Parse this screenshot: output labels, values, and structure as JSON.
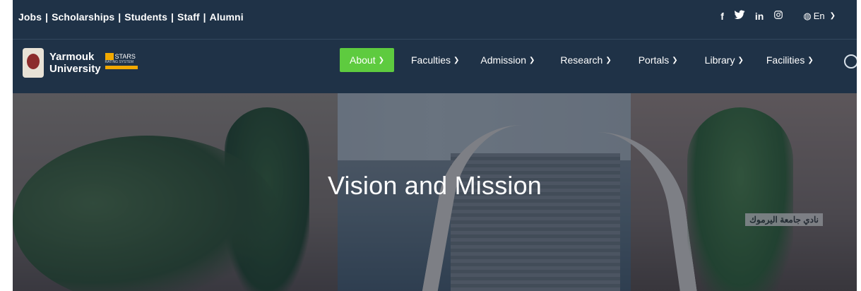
{
  "topbar": {
    "links": [
      "Jobs",
      "Scholarships",
      "Students",
      "Staff",
      "Alumni"
    ],
    "social_icons": [
      "facebook-icon",
      "twitter-icon",
      "linkedin-icon",
      "instagram-icon"
    ],
    "language": "En"
  },
  "brand": {
    "name_line1": "Yarmouk",
    "name_line2": "University",
    "stars_badge": "STARS",
    "stars_sub": "RATING SYSTEM"
  },
  "nav": {
    "items": [
      {
        "label": "About"
      },
      {
        "label": "Faculties"
      },
      {
        "label": "Admission"
      },
      {
        "label": "Research"
      },
      {
        "label": "Portals"
      },
      {
        "label": "Library"
      },
      {
        "label": "Facilities"
      }
    ],
    "active_index": 0
  },
  "hero": {
    "title": "Vision and Mission",
    "sign_text": "نادي جامعة اليرموك"
  },
  "colors": {
    "navy": "#1f3247",
    "accent_green": "#5ecb3f"
  }
}
